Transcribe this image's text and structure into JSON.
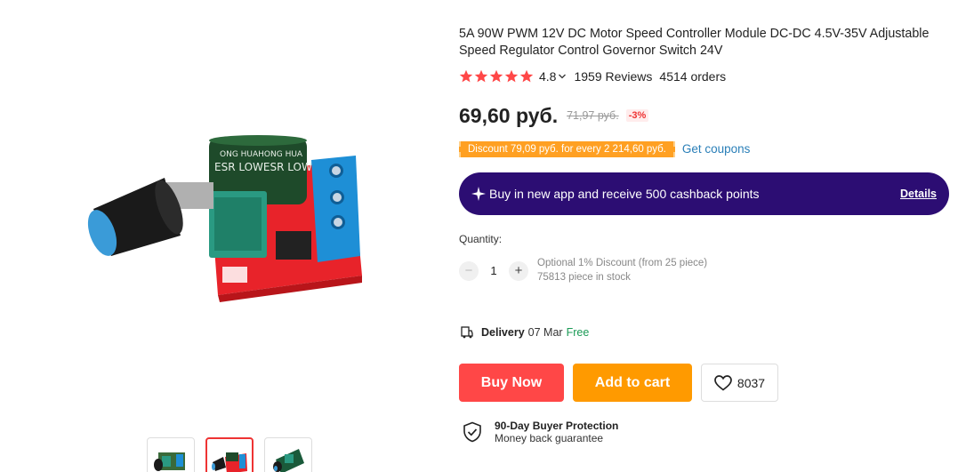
{
  "product": {
    "title": "5A 90W PWM 12V DC Motor Speed Controller Module DC-DC 4.5V-35V Adjustable Speed Regulator Control Governor Switch 24V",
    "rating": "4.8",
    "reviews": "1959 Reviews",
    "orders": "4514 orders",
    "price": "69,60 руб.",
    "old_price": "71,97 руб.",
    "discount_pct": "-3%",
    "star_count": 5,
    "colors": {
      "accent": "#ff4747",
      "star": "#ff4747",
      "banner": "#2c0d73",
      "cart": "#ff9a00",
      "coupon": "#ffa022",
      "link": "#2a7fb8",
      "free": "#1a9a55"
    }
  },
  "coupon": {
    "tag": "Discount 79,09 руб. for every 2 214,60 руб.",
    "link": "Get coupons"
  },
  "app_banner": {
    "icon": "sparkle-icon",
    "text": "Buy in new app and receive 500 cashback points",
    "details": "Details"
  },
  "quantity": {
    "label": "Quantity:",
    "value": "1",
    "minus": "−",
    "plus": "+",
    "note1": "Optional 1% Discount (from 25 piece)",
    "note2": "75813 piece in stock"
  },
  "delivery": {
    "icon": "delivery-icon",
    "label": "Delivery",
    "date": "07 Mar",
    "free": "Free"
  },
  "actions": {
    "buy_now": "Buy Now",
    "add_to_cart": "Add to cart",
    "wishlist_count": "8037"
  },
  "protection": {
    "icon": "shield-check-icon",
    "title": "90-Day Buyer Protection",
    "subtitle": "Money back guarantee"
  },
  "gallery": {
    "thumbnails": [
      "thumb-1",
      "thumb-2",
      "thumb-3"
    ],
    "active_index": 1
  }
}
